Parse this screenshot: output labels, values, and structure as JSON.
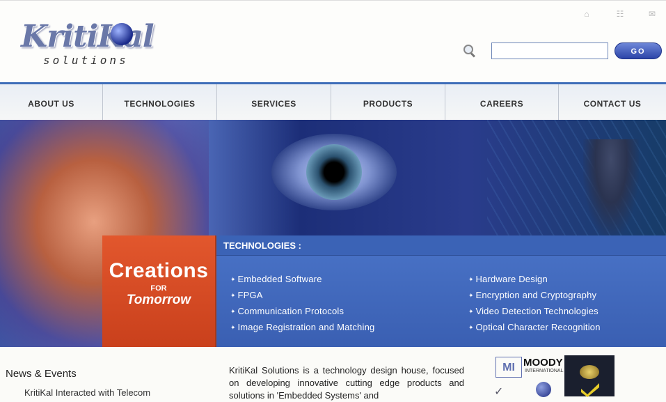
{
  "header": {
    "logo_text": "KritiKal",
    "logo_tagline": "solutions",
    "search": {
      "value": "",
      "placeholder": ""
    },
    "go_label": "GO"
  },
  "nav": {
    "items": [
      {
        "label": "ABOUT US"
      },
      {
        "label": "TECHNOLOGIES"
      },
      {
        "label": "SERVICES"
      },
      {
        "label": "PRODUCTS"
      },
      {
        "label": "CAREERS"
      },
      {
        "label": "CONTACT US"
      }
    ]
  },
  "hero": {
    "creations": "Creations",
    "for": "FOR",
    "tomorrow": "Tomorrow",
    "tech_title": "TECHNOLOGIES :",
    "tech_left": [
      "Embedded Software",
      "FPGA",
      "Communication Protocols",
      "Image Registration and Matching"
    ],
    "tech_right": [
      "Hardware Design",
      "Encryption and Cryptography",
      "Video Detection Technologies",
      "Optical Character Recognition"
    ]
  },
  "news": {
    "title": "News & Events",
    "item": "KritiKal Interacted with Telecom"
  },
  "about": {
    "text": "KritiKal Solutions is a technology design house, focused on developing innovative cutting edge products and solutions in 'Embedded Systems' and"
  },
  "certs": {
    "moody": "MOODY",
    "moody_sub": "INTERNATIONAL"
  },
  "colors": {
    "nav_accent": "#3e6db8",
    "creations_bg": "#d64a22",
    "tech_panel_bg": "#4068bd",
    "go_button": "#3650b8"
  }
}
